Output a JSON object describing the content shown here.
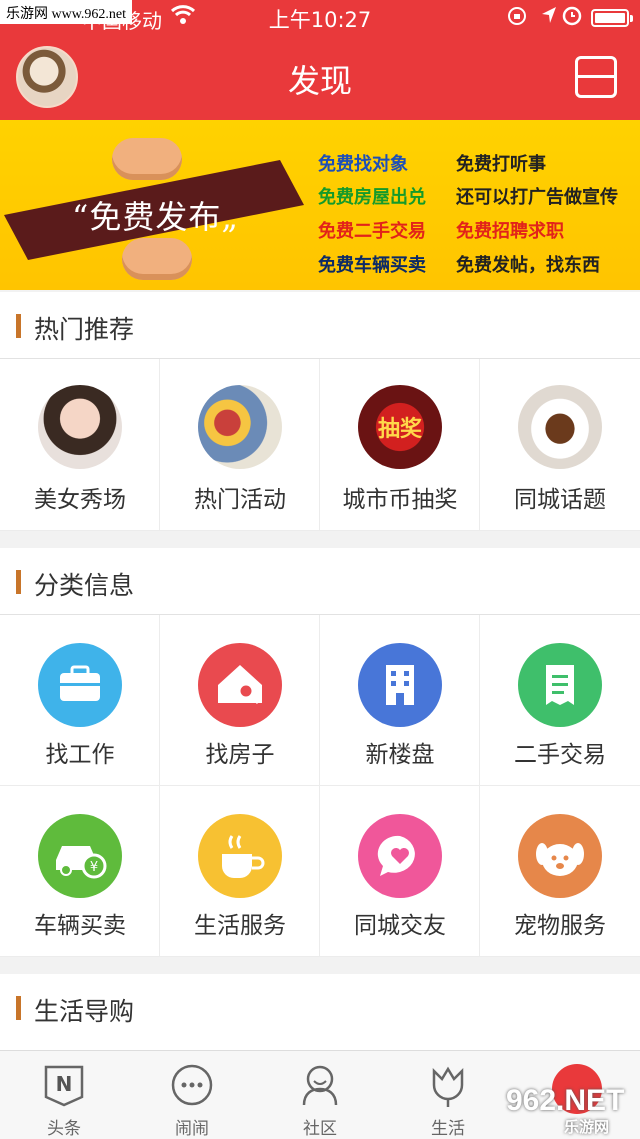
{
  "watermark": {
    "top": "乐游网 www.962.net",
    "bottom_big": "962.NET",
    "bottom_small": "乐游网"
  },
  "status_bar": {
    "carrier": "中国移动",
    "time": "上午10:27"
  },
  "header": {
    "title": "发现"
  },
  "banner": {
    "slogan": "“免费发布„",
    "items": [
      {
        "text": "免费找对象",
        "color": "blue"
      },
      {
        "text": "免费打听事",
        "color": "dark"
      },
      {
        "text": "免费房屋出兑",
        "color": "green"
      },
      {
        "text": "还可以打广告做宣传",
        "color": "dark"
      },
      {
        "text": "免费二手交易",
        "color": "red"
      },
      {
        "text": "免费招聘求职",
        "color": "red"
      },
      {
        "text": "免费车辆买卖",
        "color": "navy"
      },
      {
        "text": "免费发帖，找东西",
        "color": "dark"
      }
    ]
  },
  "sections": {
    "hot": {
      "title": "热门推荐",
      "items": [
        {
          "label": "美女秀场",
          "icon": "photo-girl"
        },
        {
          "label": "热门活动",
          "icon": "photo-party"
        },
        {
          "label": "城市币抽奖",
          "icon": "photo-lottery",
          "icon_text": "抽奖"
        },
        {
          "label": "同城话题",
          "icon": "photo-coffee"
        }
      ]
    },
    "category": {
      "title": "分类信息",
      "items": [
        {
          "label": "找工作",
          "icon": "briefcase-icon",
          "color": "#3fb3ea"
        },
        {
          "label": "找房子",
          "icon": "house-search-icon",
          "color": "#e94a4f"
        },
        {
          "label": "新楼盘",
          "icon": "building-icon",
          "color": "#4876d8"
        },
        {
          "label": "二手交易",
          "icon": "receipt-icon",
          "color": "#3fbf6b"
        },
        {
          "label": "车辆买卖",
          "icon": "car-icon",
          "color": "#5fbb3c"
        },
        {
          "label": "生活服务",
          "icon": "coffee-cup-icon",
          "color": "#f7c132"
        },
        {
          "label": "同城交友",
          "icon": "heart-chat-icon",
          "color": "#f0579a"
        },
        {
          "label": "宠物服务",
          "icon": "dog-icon",
          "color": "#e6874a"
        }
      ]
    },
    "shopping": {
      "title": "生活导购"
    }
  },
  "tabbar": {
    "tabs": [
      {
        "label": "头条",
        "icon": "headline-icon"
      },
      {
        "label": "闹闹",
        "icon": "chat-bubble-icon"
      },
      {
        "label": "社区",
        "icon": "community-icon"
      },
      {
        "label": "生活",
        "icon": "tulip-icon"
      },
      {
        "label": "",
        "icon": "location-icon"
      }
    ]
  }
}
